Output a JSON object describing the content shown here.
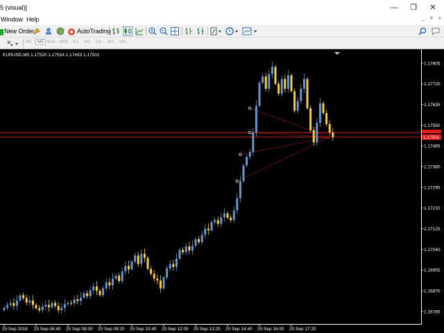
{
  "window": {
    "title": "5 (visual)]",
    "controls": {
      "minimize": "—",
      "restore": "❐",
      "close": "✕"
    }
  },
  "menu": {
    "items": [
      "Window",
      "Help"
    ],
    "mdi": [
      "_",
      "#",
      "x"
    ]
  },
  "toolbar": {
    "new_order": "New Order",
    "autotrading": "AutoTrading"
  },
  "timeframes": [
    "M1",
    "M5",
    "M15",
    "M30",
    "H1",
    "H4",
    "D1",
    "W1",
    "MN"
  ],
  "timeframe_active": "M5",
  "chart_info": "EURUSD,M5  1.17520 1.17554 1.17493 1.17501",
  "colors": {
    "bull": "#6a96c9",
    "bear": "#f6cf45",
    "line": "#ff2b2b",
    "badge": "#e31b1b"
  },
  "chart_data": {
    "type": "candlestick",
    "symbol": "EURUSD",
    "timeframe": "M5",
    "ylim": [
      1.16745,
      1.17845
    ],
    "y_ticks": [
      "1.17805",
      "1.17720",
      "1.17635",
      "1.17550",
      "1.17465",
      "1.17380",
      "1.17295",
      "1.17210",
      "1.17125",
      "1.17040",
      "1.16955",
      "1.16870",
      "1.16785"
    ],
    "x_ticks": [
      "20 Sep 2018",
      "20 Sep 06:40",
      "20 Sep 08:00",
      "20 Sep 09:20",
      "20 Sep 10:40",
      "20 Sep 12:00",
      "20 Sep 13:20",
      "20 Sep 14:40",
      "20 Sep 16:00",
      "20 Sep 17:20"
    ],
    "x_ticks_slot": [
      0,
      10,
      20,
      30,
      40,
      50,
      60,
      70,
      80,
      90
    ],
    "current_price": "1.17501",
    "price_lines": [
      1.1752,
      1.17501
    ],
    "close": [
      1.168,
      1.16812,
      1.1682,
      1.16808,
      1.1683,
      1.16852,
      1.1684,
      1.16822,
      1.1683,
      1.16812,
      1.16798,
      1.1679,
      1.16805,
      1.16812,
      1.16802,
      1.1682,
      1.16808,
      1.1679,
      1.168,
      1.16815,
      1.1682,
      1.16818,
      1.16835,
      1.16828,
      1.16842,
      1.1686,
      1.16848,
      1.16872,
      1.16888,
      1.1687,
      1.16852,
      1.1688,
      1.16905,
      1.16892,
      1.1692,
      1.16932,
      1.1691,
      1.1695,
      1.16972,
      1.16958,
      1.1699,
      1.17015,
      1.1698,
      1.17022,
      1.17005,
      1.1696,
      1.1694,
      1.1692,
      1.16912,
      1.1688,
      1.16925,
      1.16962,
      1.1698,
      1.16968,
      1.17002,
      1.17038,
      1.17028,
      1.17052,
      1.17035,
      1.17055,
      1.17082,
      1.1707,
      1.171,
      1.17125,
      1.17118,
      1.17152,
      1.1716,
      1.17145,
      1.17172,
      1.17188,
      1.1717,
      1.1716,
      1.172,
      1.1725,
      1.1732,
      1.17385,
      1.1742,
      1.1744,
      1.1752,
      1.1763,
      1.17725,
      1.1775,
      1.177,
      1.1776,
      1.1779,
      1.1772,
      1.1768,
      1.1774,
      1.177,
      1.17755,
      1.1769,
      1.1761,
      1.1765,
      1.177,
      1.1774,
      1.1762,
      1.1753,
      1.1748,
      1.1756,
      1.1764,
      1.176,
      1.17555,
      1.1752,
      1.17501
    ],
    "annotation_anchor": {
      "slot": 102,
      "price": 1.17501
    },
    "annotation_points": [
      {
        "slot": 77,
        "price": 1.1762
      },
      {
        "slot": 77,
        "price": 1.1752
      },
      {
        "slot": 74,
        "price": 1.1743
      },
      {
        "slot": 73,
        "price": 1.1732
      }
    ]
  }
}
